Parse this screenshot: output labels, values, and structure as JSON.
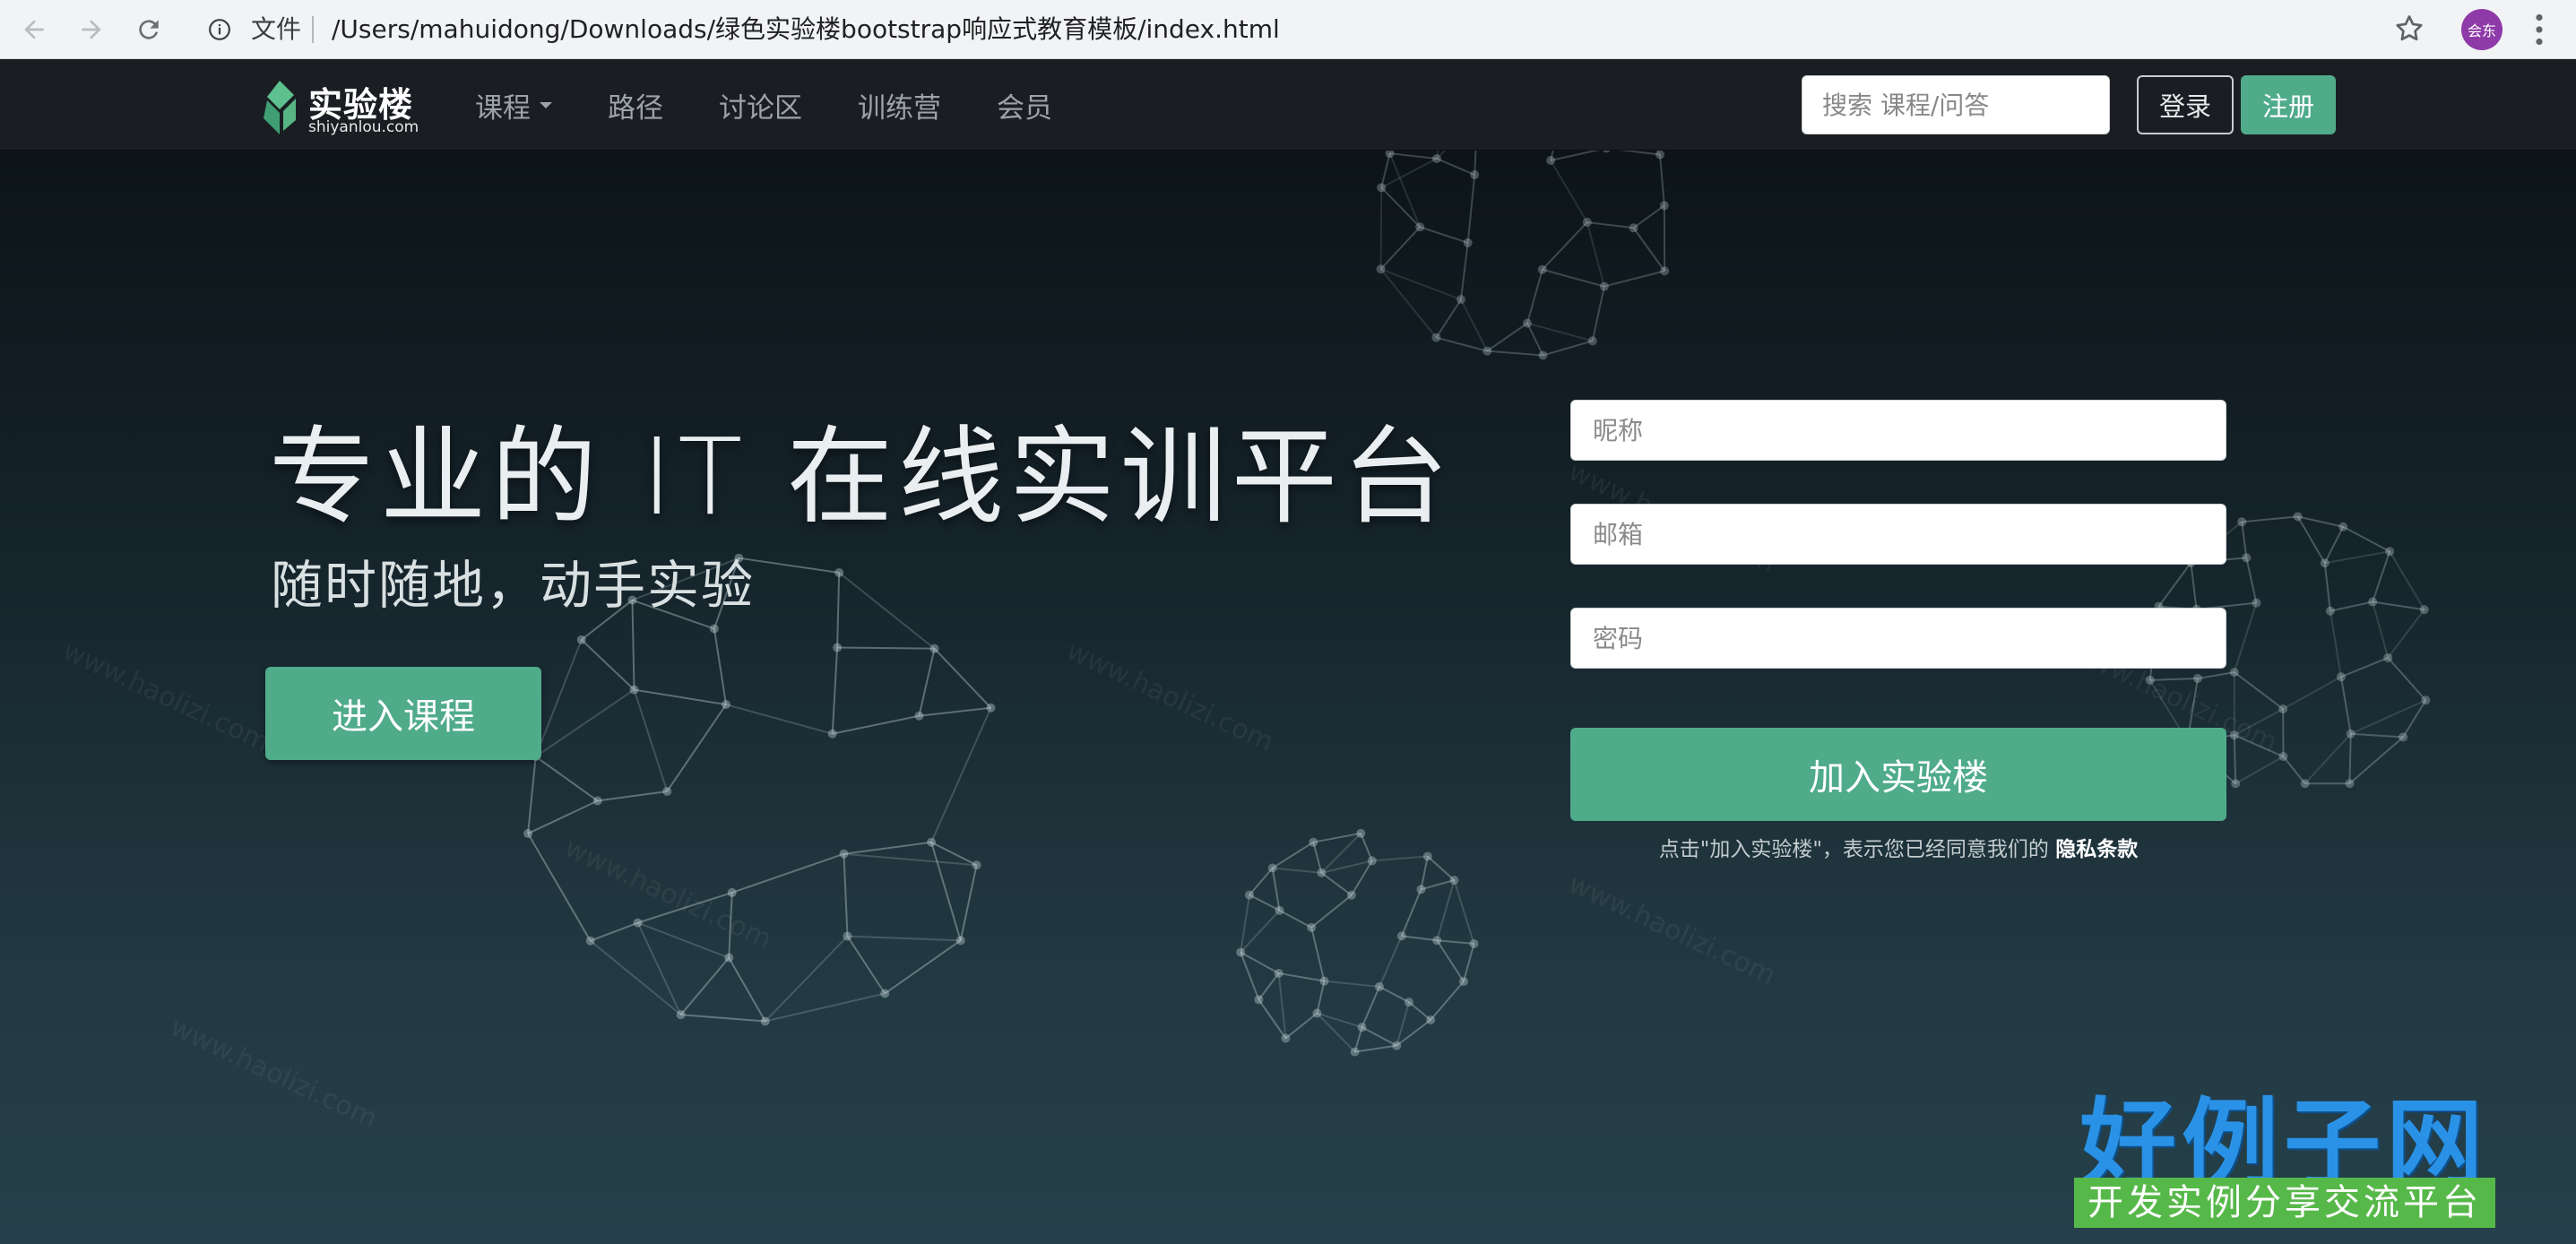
{
  "browser": {
    "file_label": "文件",
    "url": "/Users/mahuidong/Downloads/绿色实验楼bootstrap响应式教育模板/index.html",
    "profile_initials": "会东"
  },
  "nav": {
    "logo_name": "实验楼",
    "logo_domain": "shiyanlou.com",
    "menu": [
      {
        "label": "课程"
      },
      {
        "label": "路径"
      },
      {
        "label": "讨论区"
      },
      {
        "label": "训练营"
      },
      {
        "label": "会员"
      }
    ],
    "search_placeholder": "搜索 课程/问答",
    "login_label": "登录",
    "register_label": "注册"
  },
  "hero": {
    "headline": "专业的 IT 在线实训平台",
    "subline": "随时随地，动手实验",
    "enter_label": "进入课程"
  },
  "signup": {
    "nickname_placeholder": "昵称",
    "email_placeholder": "邮箱",
    "password_placeholder": "密码",
    "join_label": "加入实验楼",
    "terms_prefix": "点击\"加入实验楼\"，表示您已经同意我们的 ",
    "terms_link": "隐私条款"
  },
  "watermark": {
    "site_text": "www.haolizi.com",
    "brand_big": "好例子网",
    "brand_small": "开发实例分享交流平台"
  },
  "colors": {
    "accent": "#4fab8a",
    "navbar": "#1a1e23",
    "hero_top": "#0c1418",
    "hero_bottom": "#25404a"
  }
}
